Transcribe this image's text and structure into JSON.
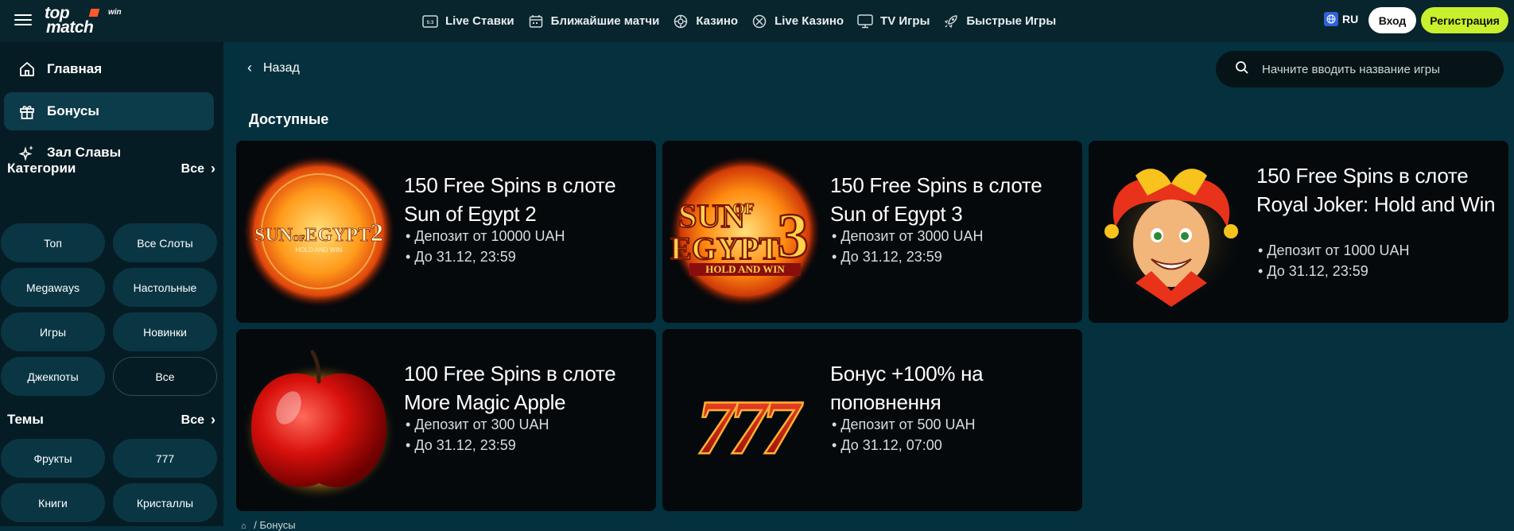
{
  "header": {
    "logo": {
      "line1": "top",
      "line2": "match",
      "win": "win"
    },
    "nav": [
      {
        "label": "Live Ставки",
        "icon": "live-bets-icon"
      },
      {
        "label": "Ближайшие матчи",
        "icon": "calendar-icon"
      },
      {
        "label": "Казино",
        "icon": "casino-chip-icon"
      },
      {
        "label": "Live Казино",
        "icon": "live-casino-icon"
      },
      {
        "label": "TV Игры",
        "icon": "tv-icon"
      },
      {
        "label": "Быстрые Игры",
        "icon": "rocket-icon"
      }
    ],
    "lang": "RU",
    "login": "Вход",
    "register": "Регистрация"
  },
  "sidebar": {
    "links": [
      {
        "label": "Главная",
        "icon": "home-icon"
      },
      {
        "label": "Бонусы",
        "icon": "gift-icon"
      },
      {
        "label": "Зал Славы",
        "icon": "sparkle-icon"
      }
    ],
    "categories": {
      "title": "Категории",
      "all": "Все",
      "items": [
        "Топ",
        "Все Слоты",
        "Megaways",
        "Настольные",
        "Игры",
        "Новинки",
        "Джекпоты",
        "Все"
      ]
    },
    "themes": {
      "title": "Темы",
      "all": "Все",
      "items": [
        "Фрукты",
        "777",
        "Книги",
        "Кристаллы"
      ]
    }
  },
  "main": {
    "back": "Назад",
    "search_placeholder": "Начните вводить название игры",
    "section_title": "Доступные",
    "cards": [
      {
        "title": "150  Free Spins в слоте Sun of Egypt 2",
        "deposit": "Депозит от 10000 UAH",
        "until": "До 31.12, 23:59",
        "art": "sun-of-egypt-2"
      },
      {
        "title": "150  Free Spins в слоте Sun of Egypt 3",
        "deposit": "Депозит от 3000 UAH",
        "until": "До 31.12, 23:59",
        "art": "sun-of-egypt-3"
      },
      {
        "title": "150  Free Spins в слоте Royal Joker: Hold and Win",
        "deposit": "Депозит от 1000 UAH",
        "until": "До 31.12, 23:59",
        "art": "royal-joker"
      },
      {
        "title": "100  Free Spins в слоте More Magic Apple",
        "deposit": "Депозит от 300 UAH",
        "until": "До 31.12, 23:59",
        "art": "magic-apple"
      },
      {
        "title": "Бонус +100% на поповнення",
        "deposit": "Депозит от 500 UAH",
        "until": "До 31.12, 07:00",
        "art": "triple-seven"
      }
    ],
    "art_text": {
      "soe2_word1": "SUN",
      "soe2_word2": "OF",
      "soe2_word3": "EGYPT",
      "soe2_num": "2",
      "soe2_sub": "HOLD AND WIN",
      "soe3_word1": "SUN",
      "soe3_word2": "OF",
      "soe3_word3": "EGYPT",
      "soe3_num": "3",
      "soe3_sub": "HOLD AND WIN",
      "sevens": "777"
    },
    "breadcrumb": "/  Бонусы"
  },
  "colors": {
    "accent": "#c8f02c",
    "bg": "#04313d",
    "sidebar": "#061c24",
    "card": "#05090c"
  }
}
